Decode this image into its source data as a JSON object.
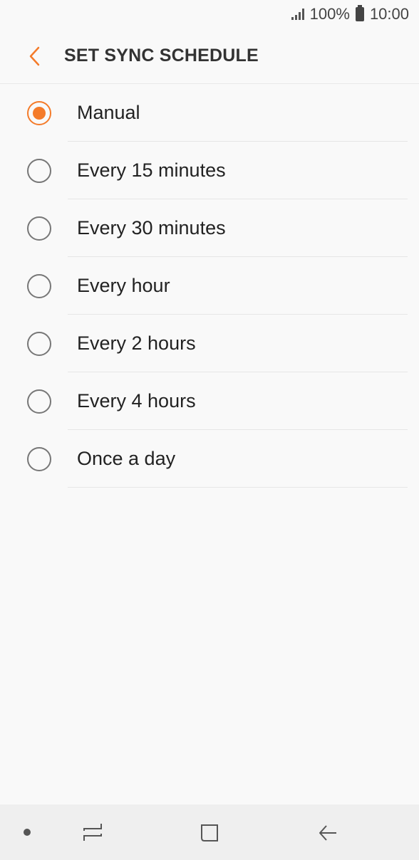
{
  "status_bar": {
    "battery_text": "100%",
    "time": "10:00",
    "icons": [
      "signal-icon",
      "battery-icon"
    ]
  },
  "header": {
    "back_icon": "chevron-left-icon",
    "title": "SET SYNC SCHEDULE"
  },
  "options": [
    {
      "label": "Manual",
      "selected": true
    },
    {
      "label": "Every 15 minutes",
      "selected": false
    },
    {
      "label": "Every 30 minutes",
      "selected": false
    },
    {
      "label": "Every hour",
      "selected": false
    },
    {
      "label": "Every 2 hours",
      "selected": false
    },
    {
      "label": "Every 4 hours",
      "selected": false
    },
    {
      "label": "Once a day",
      "selected": false
    }
  ],
  "navbar": {
    "icons": [
      "dot-icon",
      "recents-icon",
      "home-icon",
      "back-arrow-icon"
    ]
  },
  "colors": {
    "accent": "#f47b2a",
    "background": "#f9f9f9",
    "navbar": "#efefef"
  }
}
